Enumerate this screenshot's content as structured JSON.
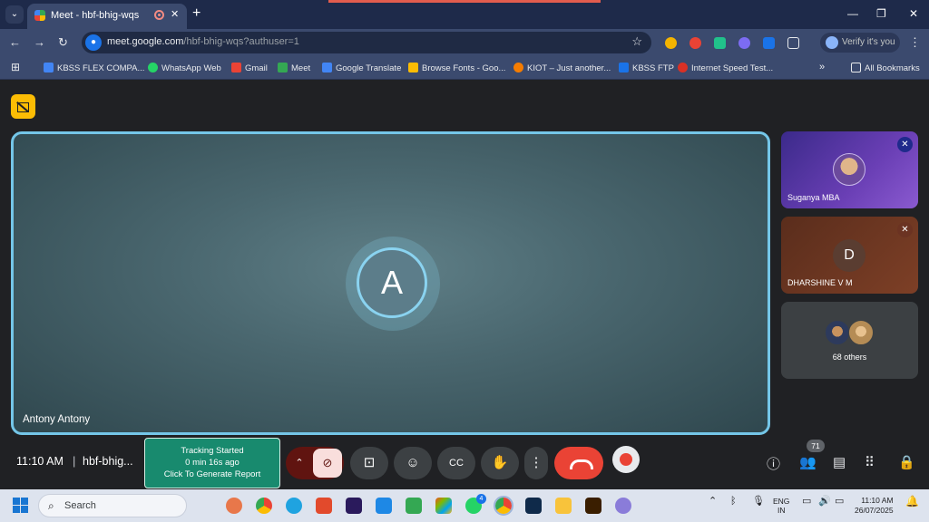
{
  "browser": {
    "tab_title": "Meet - hbf-bhig-wqs",
    "tab_close": "✕",
    "new_tab": "+",
    "window_controls": {
      "minimize": "—",
      "restore": "❐",
      "close": "✕"
    },
    "url_domain": "meet.google.com",
    "url_path": "/hbf-bhig-wqs?authuser=1",
    "profile_label": "Verify it's you"
  },
  "bookmarks": {
    "items": [
      {
        "label": "KBSS FLEX COMPA...",
        "color": "#4285f4"
      },
      {
        "label": "WhatsApp Web",
        "color": "#25d366"
      },
      {
        "label": "Gmail",
        "color": "#ea4335"
      },
      {
        "label": "Meet",
        "color": "#34a853"
      },
      {
        "label": "Google Translate",
        "color": "#4285f4"
      },
      {
        "label": "Browse Fonts - Goo...",
        "color": "#fbbc04"
      },
      {
        "label": "KIOT – Just another...",
        "color": "#f57c00"
      },
      {
        "label": "KBSS FTP",
        "color": "#1a73e8"
      },
      {
        "label": "Internet Speed Test...",
        "color": "#d93025"
      }
    ],
    "overflow": "»",
    "all_bookmarks": "All Bookmarks"
  },
  "meet": {
    "main_participant": {
      "initial": "A",
      "name": "Antony Antony"
    },
    "side_tiles": [
      {
        "name": "Suganya MBA",
        "muted": true,
        "type": "photo"
      },
      {
        "name": "DHARSHINE V M",
        "initial": "D",
        "muted": true,
        "type": "initial"
      },
      {
        "name": "68 others",
        "type": "group"
      }
    ],
    "time": "11:10 AM",
    "separator": "|",
    "meeting_code": "hbf-bhig...",
    "tracking": {
      "line1": "Tracking Started",
      "line2": "0 min 16s ago",
      "line3": "Click To Generate Report"
    },
    "participant_count": "71"
  },
  "taskbar": {
    "search_label": "Search",
    "whatsapp_badge": "4",
    "lang_line1": "ENG",
    "lang_line2": "IN",
    "clock_time": "11:10 AM",
    "clock_date": "26/07/2025"
  }
}
